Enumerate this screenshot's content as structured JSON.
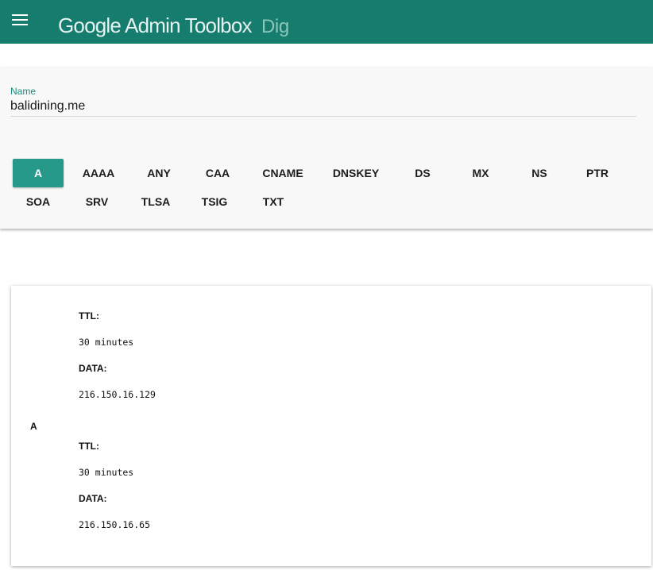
{
  "header": {
    "title": "Google Admin Toolbox",
    "subtitle": "Dig",
    "accent_color": "#167c6e"
  },
  "query": {
    "name_label": "Name",
    "name_value": "balidining.me",
    "selected_type": "A",
    "record_types": [
      "A",
      "AAAA",
      "ANY",
      "CAA",
      "CNAME",
      "DNSKEY",
      "DS",
      "MX",
      "NS",
      "PTR",
      "SOA",
      "SRV",
      "TLSA",
      "TSIG",
      "TXT"
    ]
  },
  "results": {
    "records": [
      {
        "type": "",
        "ttl_label": "TTL:",
        "ttl": "30 minutes",
        "data_label": "DATA:",
        "data": "216.150.16.129"
      },
      {
        "type": "A",
        "ttl_label": "TTL:",
        "ttl": "30 minutes",
        "data_label": "DATA:",
        "data": "216.150.16.65"
      }
    ]
  }
}
